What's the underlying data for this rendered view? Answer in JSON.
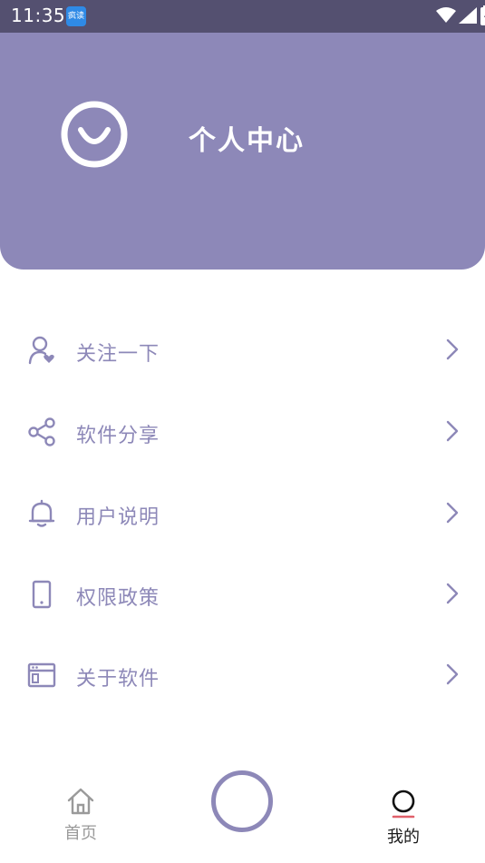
{
  "status_bar": {
    "time": "11:35",
    "app_badge_label": "疯读"
  },
  "header": {
    "title": "个人中心",
    "background_color": "#8d88b8"
  },
  "menu": {
    "items": [
      {
        "label": "关注一下",
        "icon": "user-heart-icon"
      },
      {
        "label": "软件分享",
        "icon": "share-icon"
      },
      {
        "label": "用户说明",
        "icon": "bell-icon"
      },
      {
        "label": "权限政策",
        "icon": "phone-icon"
      },
      {
        "label": "关于软件",
        "icon": "browser-window-icon"
      }
    ],
    "text_color": "#8d88b8"
  },
  "bottom_nav": {
    "items": [
      {
        "label": "首页",
        "icon": "home-icon",
        "active": false
      },
      {
        "label": "",
        "icon": "center-circle-button",
        "active": false
      },
      {
        "label": "我的",
        "icon": "profile-circle-icon",
        "active": true
      }
    ],
    "active_underline_color": "#e0606a"
  }
}
